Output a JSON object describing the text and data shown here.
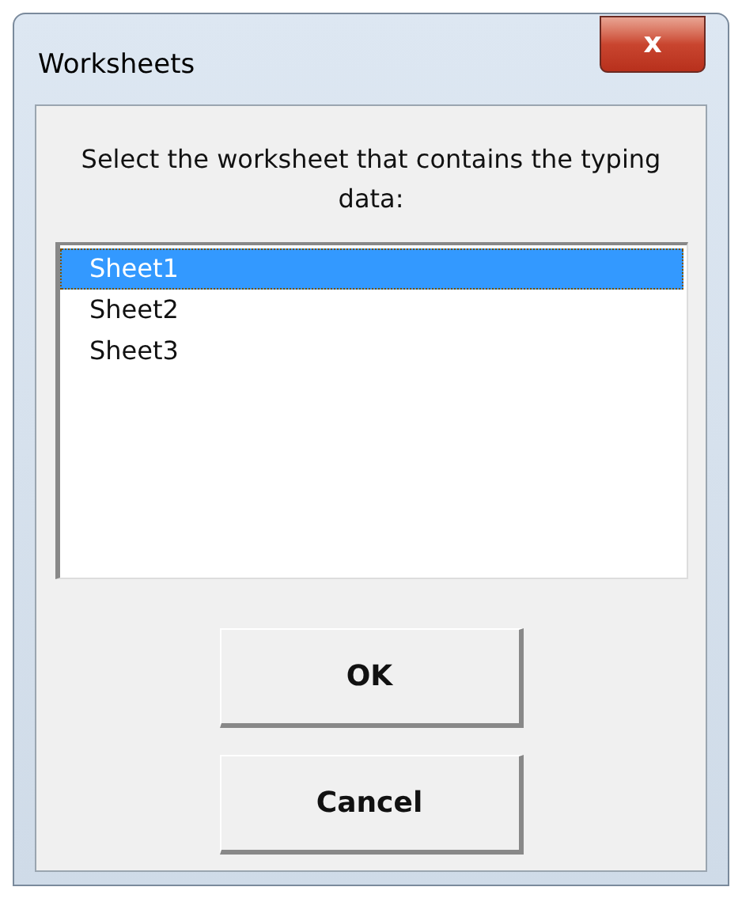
{
  "window": {
    "title": "Worksheets"
  },
  "close_button": {
    "label": "x"
  },
  "prompt": "Select the worksheet that contains the typing data:",
  "sheets": [
    {
      "label": "Sheet1",
      "selected": true
    },
    {
      "label": "Sheet2",
      "selected": false
    },
    {
      "label": "Sheet3",
      "selected": false
    }
  ],
  "buttons": [
    "OK",
    "Cancel"
  ]
}
